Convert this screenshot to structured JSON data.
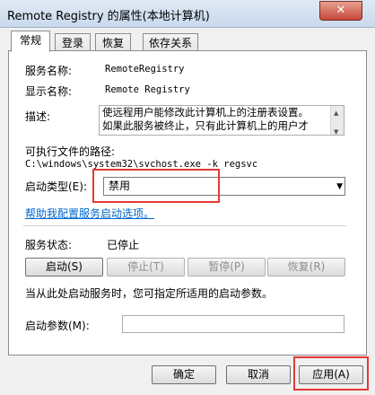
{
  "window": {
    "title": "Remote Registry 的属性(本地计算机)",
    "close_glyph": "✕"
  },
  "tabs": [
    {
      "label": "常规",
      "active": true
    },
    {
      "label": "登录"
    },
    {
      "label": "恢复"
    },
    {
      "label": "依存关系"
    }
  ],
  "general": {
    "service_name_label": "服务名称:",
    "service_name_value": "RemoteRegistry",
    "display_name_label": "显示名称:",
    "display_name_value": "Remote Registry",
    "description_label": "描述:",
    "description_line1": "使远程用户能修改此计算机上的注册表设置。",
    "description_line2": "如果此服务被终止，只有此计算机上的用户才",
    "path_label": "可执行文件的路径:",
    "path_value": "C:\\windows\\system32\\svchost.exe -k regsvc",
    "startup_type_label": "启动类型(E):",
    "startup_type_value": "禁用",
    "help_link": "帮助我配置服务启动选项。",
    "status_label": "服务状态:",
    "status_value": "已停止",
    "buttons": {
      "start": "启动(S)",
      "stop": "停止(T)",
      "pause": "暂停(P)",
      "resume": "恢复(R)"
    },
    "start_params_note": "当从此处启动服务时，您可指定所适用的启动参数。",
    "start_params_label": "启动参数(M):",
    "start_params_value": ""
  },
  "footer": {
    "ok": "确定",
    "cancel": "取消",
    "apply": "应用(A)"
  },
  "highlight_color": "#e53935"
}
